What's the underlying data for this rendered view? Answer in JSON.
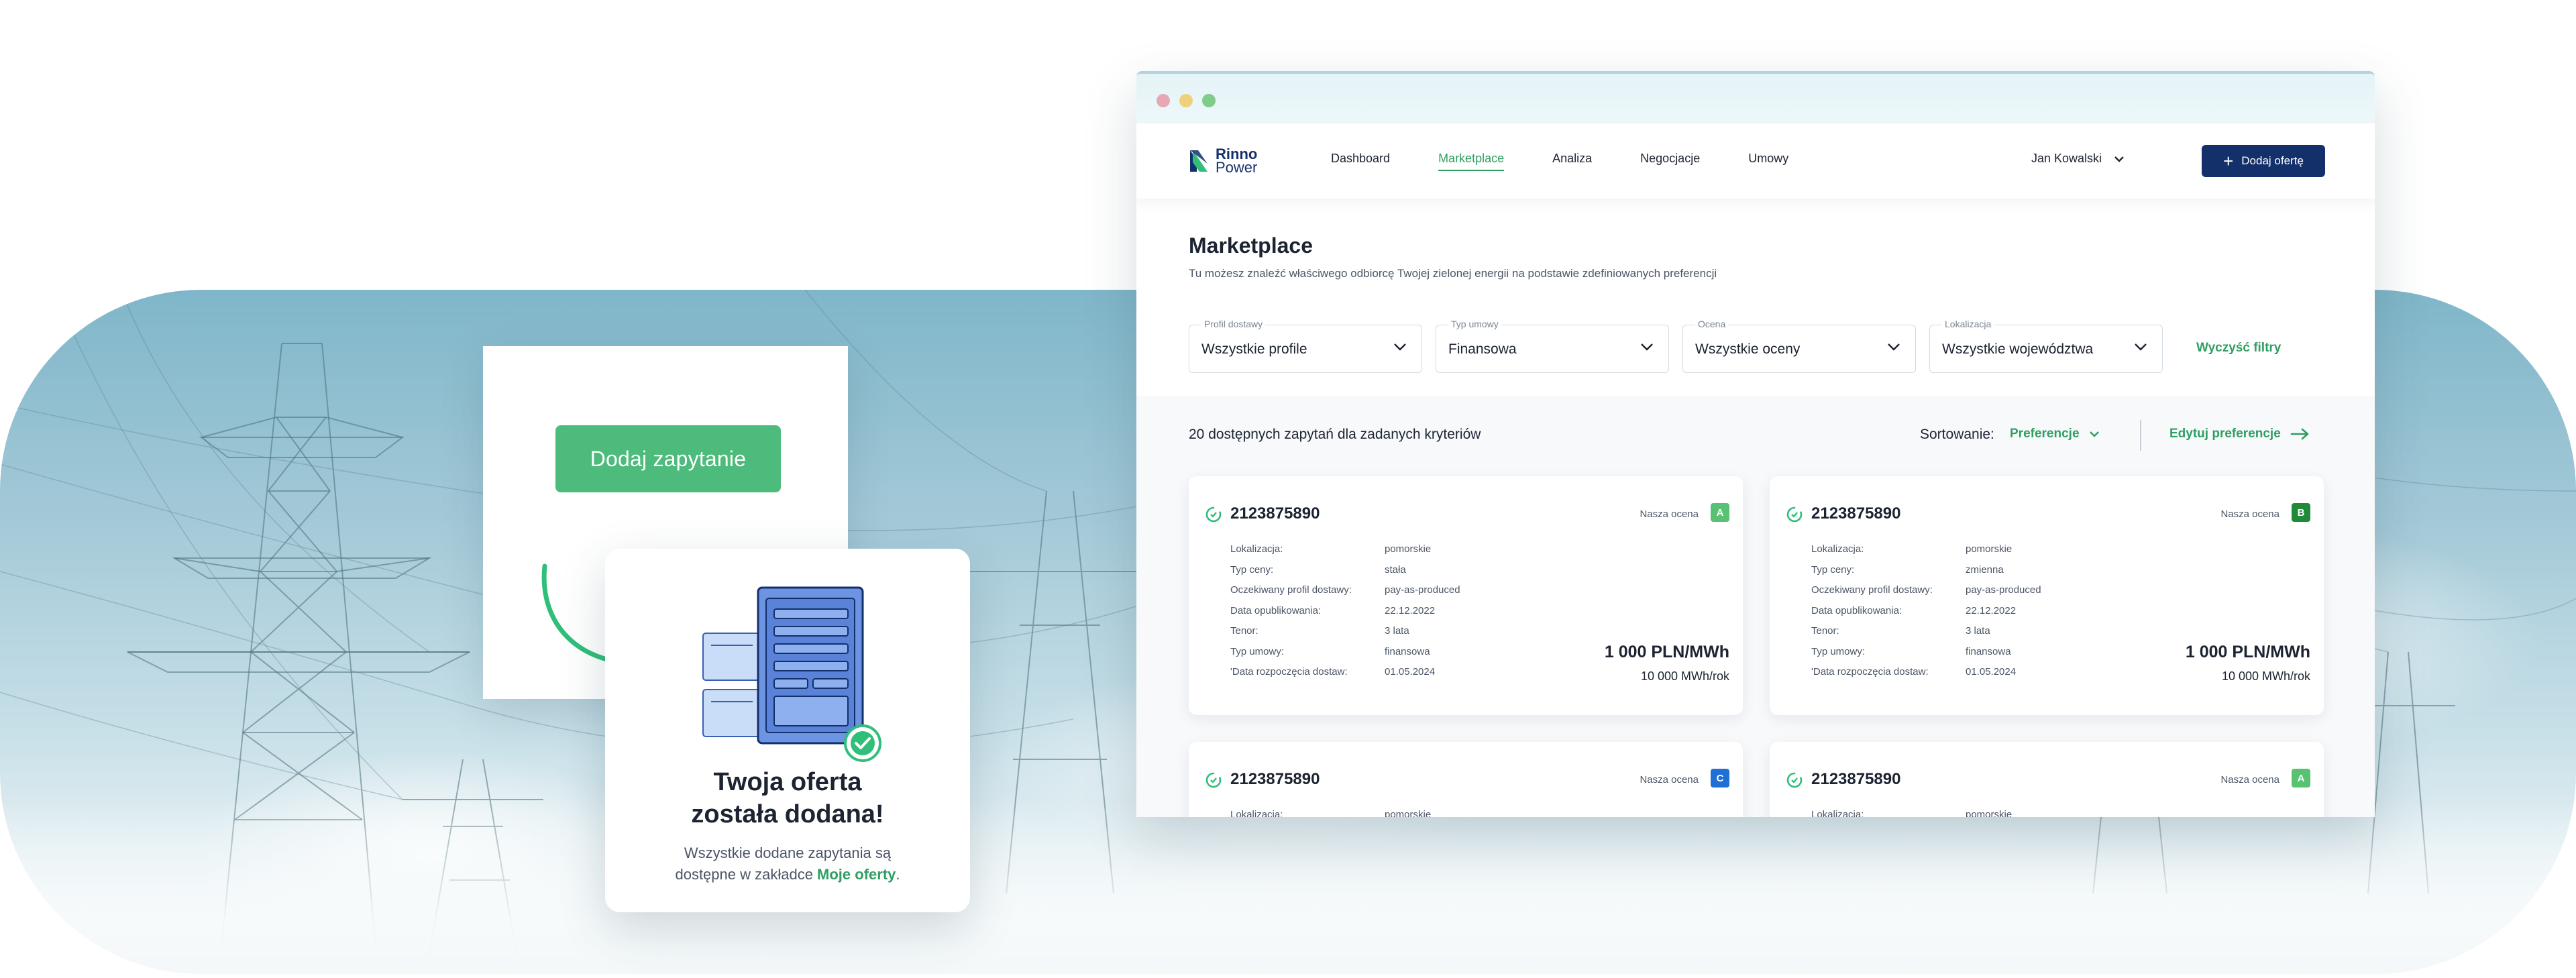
{
  "left_panel": {
    "add_query_button": "Dodaj zapytanie",
    "confirmation": {
      "title_line1": "Twoja oferta",
      "title_line2": "została dodana!",
      "text_before": "Wszystkie dodane zapytania są",
      "text_line2_before": "dostępne w zakładce ",
      "link": "Moje oferty",
      "text_after": "."
    }
  },
  "browser": {
    "logo": {
      "line1": "Rinno",
      "line2": "Power"
    },
    "nav": [
      {
        "label": "Dashboard",
        "active": false
      },
      {
        "label": "Marketplace",
        "active": true
      },
      {
        "label": "Analiza",
        "active": false
      },
      {
        "label": "Negocjacje",
        "active": false
      },
      {
        "label": "Umowy",
        "active": false
      }
    ],
    "user_name": "Jan Kowalski",
    "add_offer_button": "Dodaj ofertę",
    "page_title": "Marketplace",
    "page_subtitle": "Tu możesz znaleźć właściwego odbiorcę Twojej zielonej energii na podstawie zdefiniowanych preferencji",
    "filters": [
      {
        "label": "Profil dostawy",
        "value": "Wszystkie profile"
      },
      {
        "label": "Typ umowy",
        "value": "Finansowa"
      },
      {
        "label": "Ocena",
        "value": "Wszystkie oceny"
      },
      {
        "label": "Lokalizacja",
        "value": "Wszystkie województwa"
      }
    ],
    "clear_filters": "Wyczyść filtry",
    "results_count": "20 dostępnych zapytań dla zadanych kryteriów",
    "sort_label": "Sortowanie:",
    "sort_value": "Preferencje",
    "edit_preferences": "Edytuj preferencje",
    "rating_label": "Nasza ocena",
    "detail_keys": [
      "Lokalizacja:",
      "Typ ceny:",
      "Oczekiwany profil dostawy:",
      "Data opublikowania:",
      "Tenor:",
      "Typ umowy:",
      "'Data rozpoczęcia dostaw:"
    ],
    "offers": [
      {
        "id": "2123875890",
        "rating": "A",
        "rating_color": "#58c272",
        "values": [
          "pomorskie",
          "stała",
          "pay-as-produced",
          "22.12.2022",
          "3 lata",
          "finansowa",
          "01.05.2024"
        ],
        "price": "1 000 PLN/MWh",
        "volume": "10 000 MWh/rok"
      },
      {
        "id": "2123875890",
        "rating": "B",
        "rating_color": "#1f8a3a",
        "values": [
          "pomorskie",
          "zmienna",
          "pay-as-produced",
          "22.12.2022",
          "3 lata",
          "finansowa",
          "01.05.2024"
        ],
        "price": "1 000 PLN/MWh",
        "volume": "10 000 MWh/rok"
      },
      {
        "id": "2123875890",
        "rating": "C",
        "rating_color": "#1f6fd6",
        "values": [
          "pomorskie",
          "",
          "",
          "",
          "",
          "",
          ""
        ],
        "price": "",
        "volume": ""
      },
      {
        "id": "2123875890",
        "rating": "A",
        "rating_color": "#58c272",
        "values": [
          "pomorskie",
          "",
          "",
          "",
          "",
          "",
          ""
        ],
        "price": "",
        "volume": ""
      }
    ]
  },
  "colors": {
    "accent_green": "#2f9e63",
    "button_green": "#4dbb7b",
    "brand_navy": "#14306b"
  },
  "icons": [
    "arrow-curve-icon",
    "document-icon",
    "check-circle-icon",
    "chevron-down-icon",
    "plus-icon",
    "arrow-right-icon",
    "offer-cycle-icon"
  ]
}
